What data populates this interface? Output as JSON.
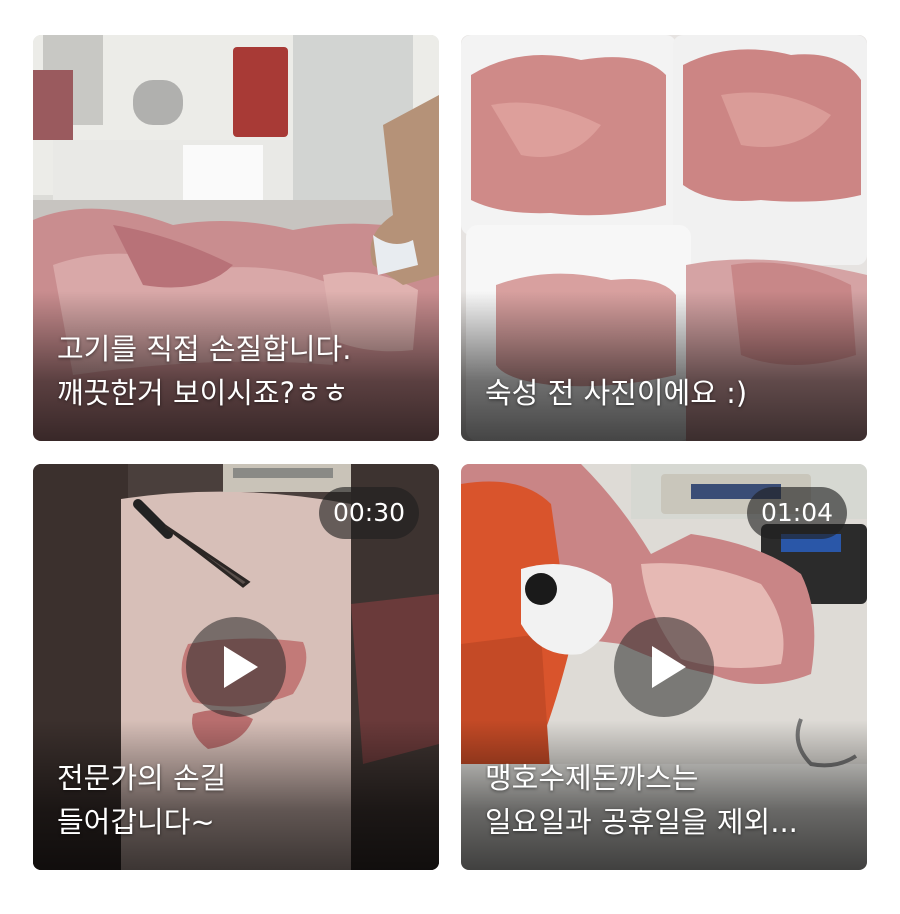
{
  "gallery": {
    "items": [
      {
        "type": "photo",
        "caption_lines": [
          "고기를 직접 손질합니다.",
          "깨끗한거 보이시죠?ㅎㅎ"
        ]
      },
      {
        "type": "photo",
        "caption_lines": [
          "숙성 전 사진이에요 :)"
        ]
      },
      {
        "type": "video",
        "duration": "00:30",
        "caption_lines": [
          "전문가의 손길",
          "들어갑니다~"
        ],
        "play_icon": "play-icon"
      },
      {
        "type": "video",
        "duration": "01:04",
        "caption_lines": [
          "맹호수제돈까스는",
          "일요일과 공휴일을 제외..."
        ],
        "play_icon": "play-icon"
      }
    ]
  },
  "colors": {
    "background": "#ffffff",
    "caption_text": "#ffffff",
    "meat": "#c9868a",
    "overlay": "#1e1e1e"
  }
}
